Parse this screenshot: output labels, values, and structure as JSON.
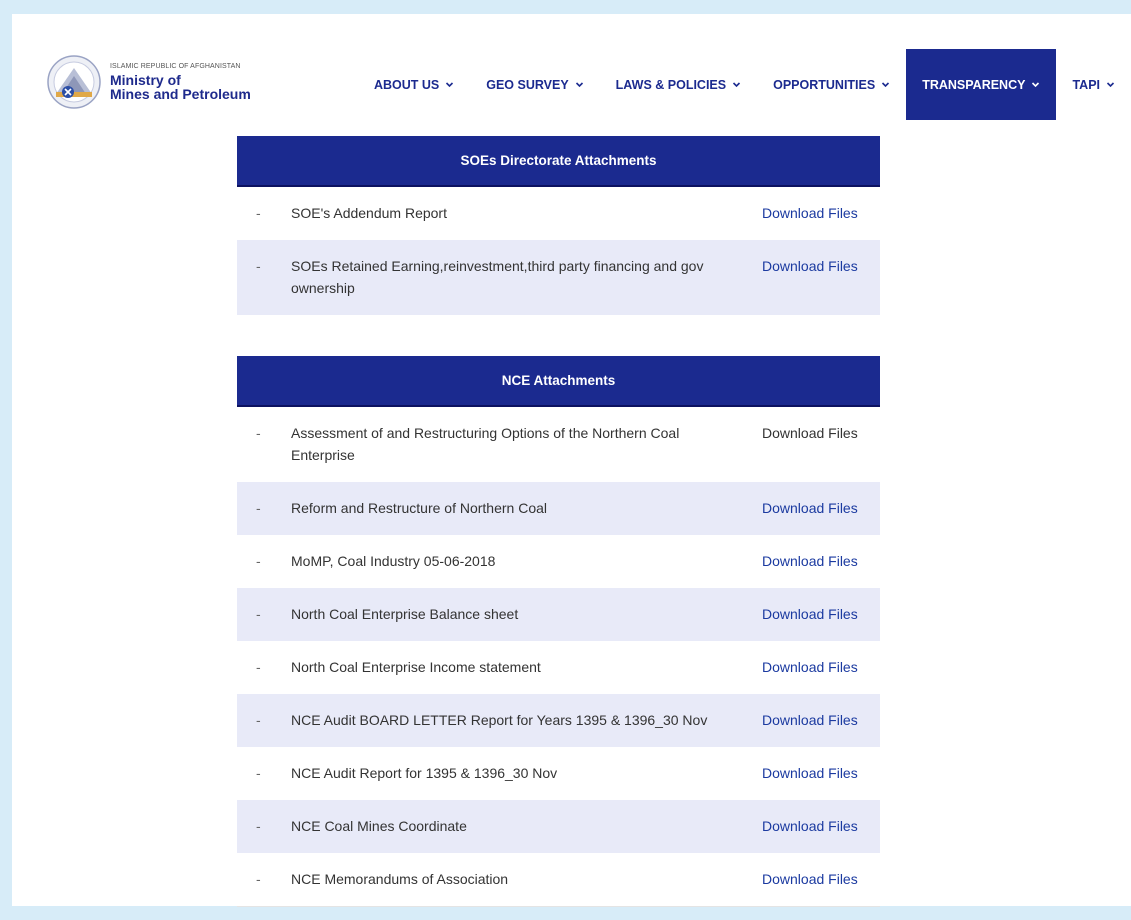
{
  "logo": {
    "small": "ISLAMIC REPUBLIC OF AFGHANISTAN",
    "line1": "Ministry of",
    "line2": "Mines and Petroleum"
  },
  "nav": [
    {
      "label": "ABOUT US"
    },
    {
      "label": "GEO SURVEY"
    },
    {
      "label": "LAWS & POLICIES"
    },
    {
      "label": "OPPORTUNITIES"
    },
    {
      "label": "TRANSPARENCY",
      "active": true
    },
    {
      "label": "TAPI"
    }
  ],
  "soe": {
    "title": "SOEs Directorate Attachments",
    "rows": [
      {
        "dash": "-",
        "label": "SOE's Addendum Report",
        "link": "Download Files"
      },
      {
        "dash": "-",
        "label": "SOEs Retained Earning,reinvestment,third party financing and gov ownership",
        "link": "Download Files"
      }
    ]
  },
  "nce": {
    "title": "NCE Attachments",
    "rows": [
      {
        "dash": "-",
        "label": "Assessment of and Restructuring Options of the Northern Coal Enterprise",
        "link": "Download Files"
      },
      {
        "dash": "-",
        "label": "Reform and Restructure of Northern Coal",
        "link": "Download Files"
      },
      {
        "dash": "-",
        "label": "MoMP, Coal Industry 05-06-2018",
        "link": "Download Files"
      },
      {
        "dash": "-",
        "label": "North Coal Enterprise Balance sheet",
        "link": "Download Files"
      },
      {
        "dash": "-",
        "label": "North Coal Enterprise Income statement",
        "link": "Download Files"
      },
      {
        "dash": "-",
        "label": "NCE Audit BOARD LETTER Report for Years 1395 & 1396_30 Nov",
        "link": "Download Files"
      },
      {
        "dash": "-",
        "label": "NCE Audit Report for 1395 & 1396_30 Nov",
        "link": "Download Files"
      },
      {
        "dash": "-",
        "label": "NCE Coal Mines Coordinate",
        "link": "Download Files"
      },
      {
        "dash": "-",
        "label": "NCE Memorandums of Association",
        "link": "Download Files"
      }
    ]
  },
  "colors": {
    "brand": "#1b2a8f",
    "link": "#1b3aa0",
    "row_alt": "#e8eaf8",
    "frame": "#d7ecf8"
  }
}
